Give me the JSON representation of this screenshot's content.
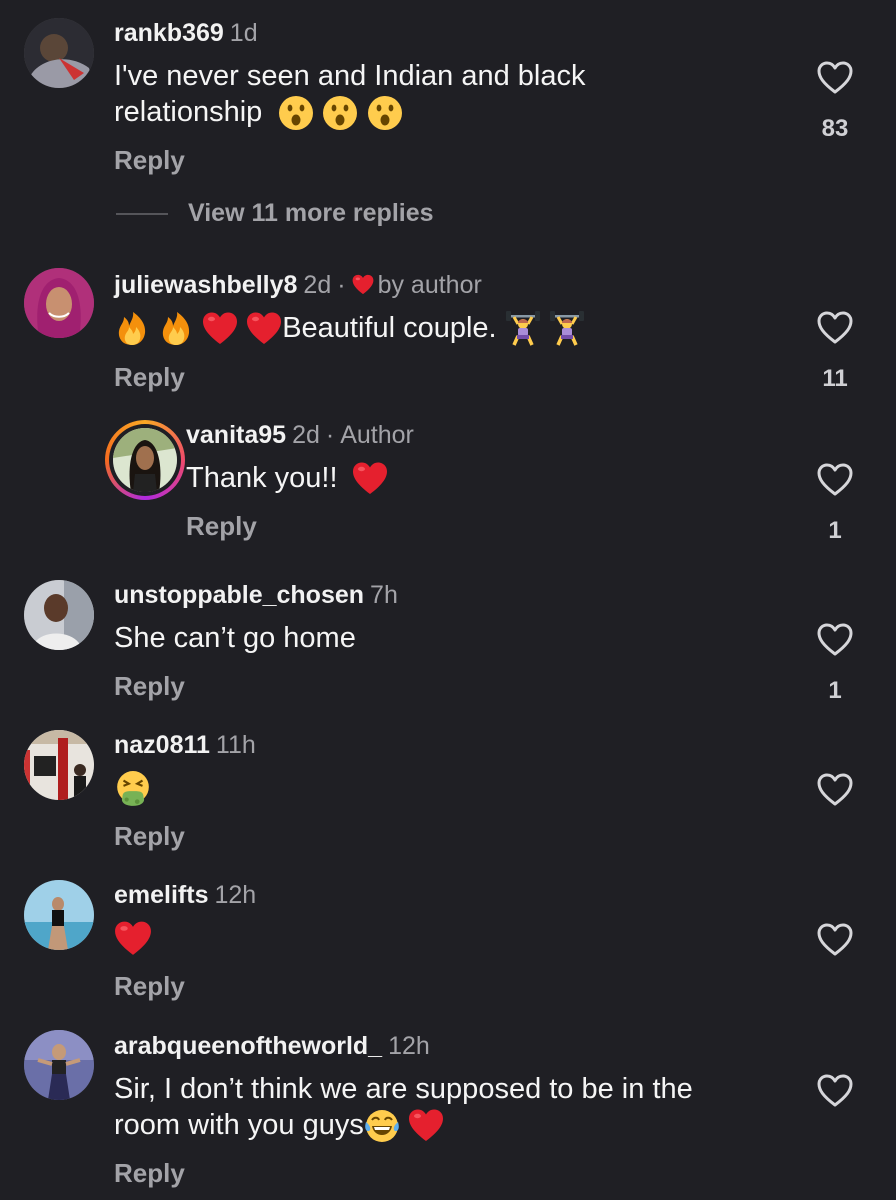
{
  "comments": [
    {
      "username": "rankb369",
      "time": "1d",
      "text": "I've never seen and Indian and black",
      "text_line2": "relationship",
      "text_emojis": [
        "hushed-face",
        "hushed-face",
        "hushed-face"
      ],
      "reply_label": "Reply",
      "likes": "83",
      "view_more": "View 11 more replies"
    },
    {
      "username": "juliewashbelly8",
      "time": "2d",
      "liked_by": "by author",
      "leading_emojis": [
        "fire",
        "fire",
        "red-heart",
        "red-heart"
      ],
      "text": "Beautiful  couple.",
      "trailing_emojis": [
        "weightlifter",
        "weightlifter"
      ],
      "reply_label": "Reply",
      "likes": "11"
    },
    {
      "username": "vanita95",
      "time": "2d",
      "author_tag": "Author",
      "text": "Thank you!!",
      "trailing_emojis": [
        "red-heart"
      ],
      "reply_label": "Reply",
      "likes": "1"
    },
    {
      "username": "unstoppable_chosen",
      "time": "7h",
      "text": "She can’t go home",
      "reply_label": "Reply",
      "likes": "1"
    },
    {
      "username": "naz0811",
      "time": "11h",
      "emojis": [
        "vomiting-face"
      ],
      "reply_label": "Reply"
    },
    {
      "username": "emelifts",
      "time": "12h",
      "emojis": [
        "red-heart"
      ],
      "reply_label": "Reply"
    },
    {
      "username": "arabqueenoftheworld_",
      "time": "12h",
      "text": "Sir, I don’t think we are supposed to be in the",
      "text_line2": "room with you guys",
      "trailing_emojis": [
        "tears-of-joy",
        "red-heart"
      ],
      "reply_label": "Reply"
    }
  ],
  "colors": {
    "background": "#1f1f24",
    "text": "#f5f5f5",
    "muted": "#a3a3a8",
    "heart": "#e5202e"
  }
}
